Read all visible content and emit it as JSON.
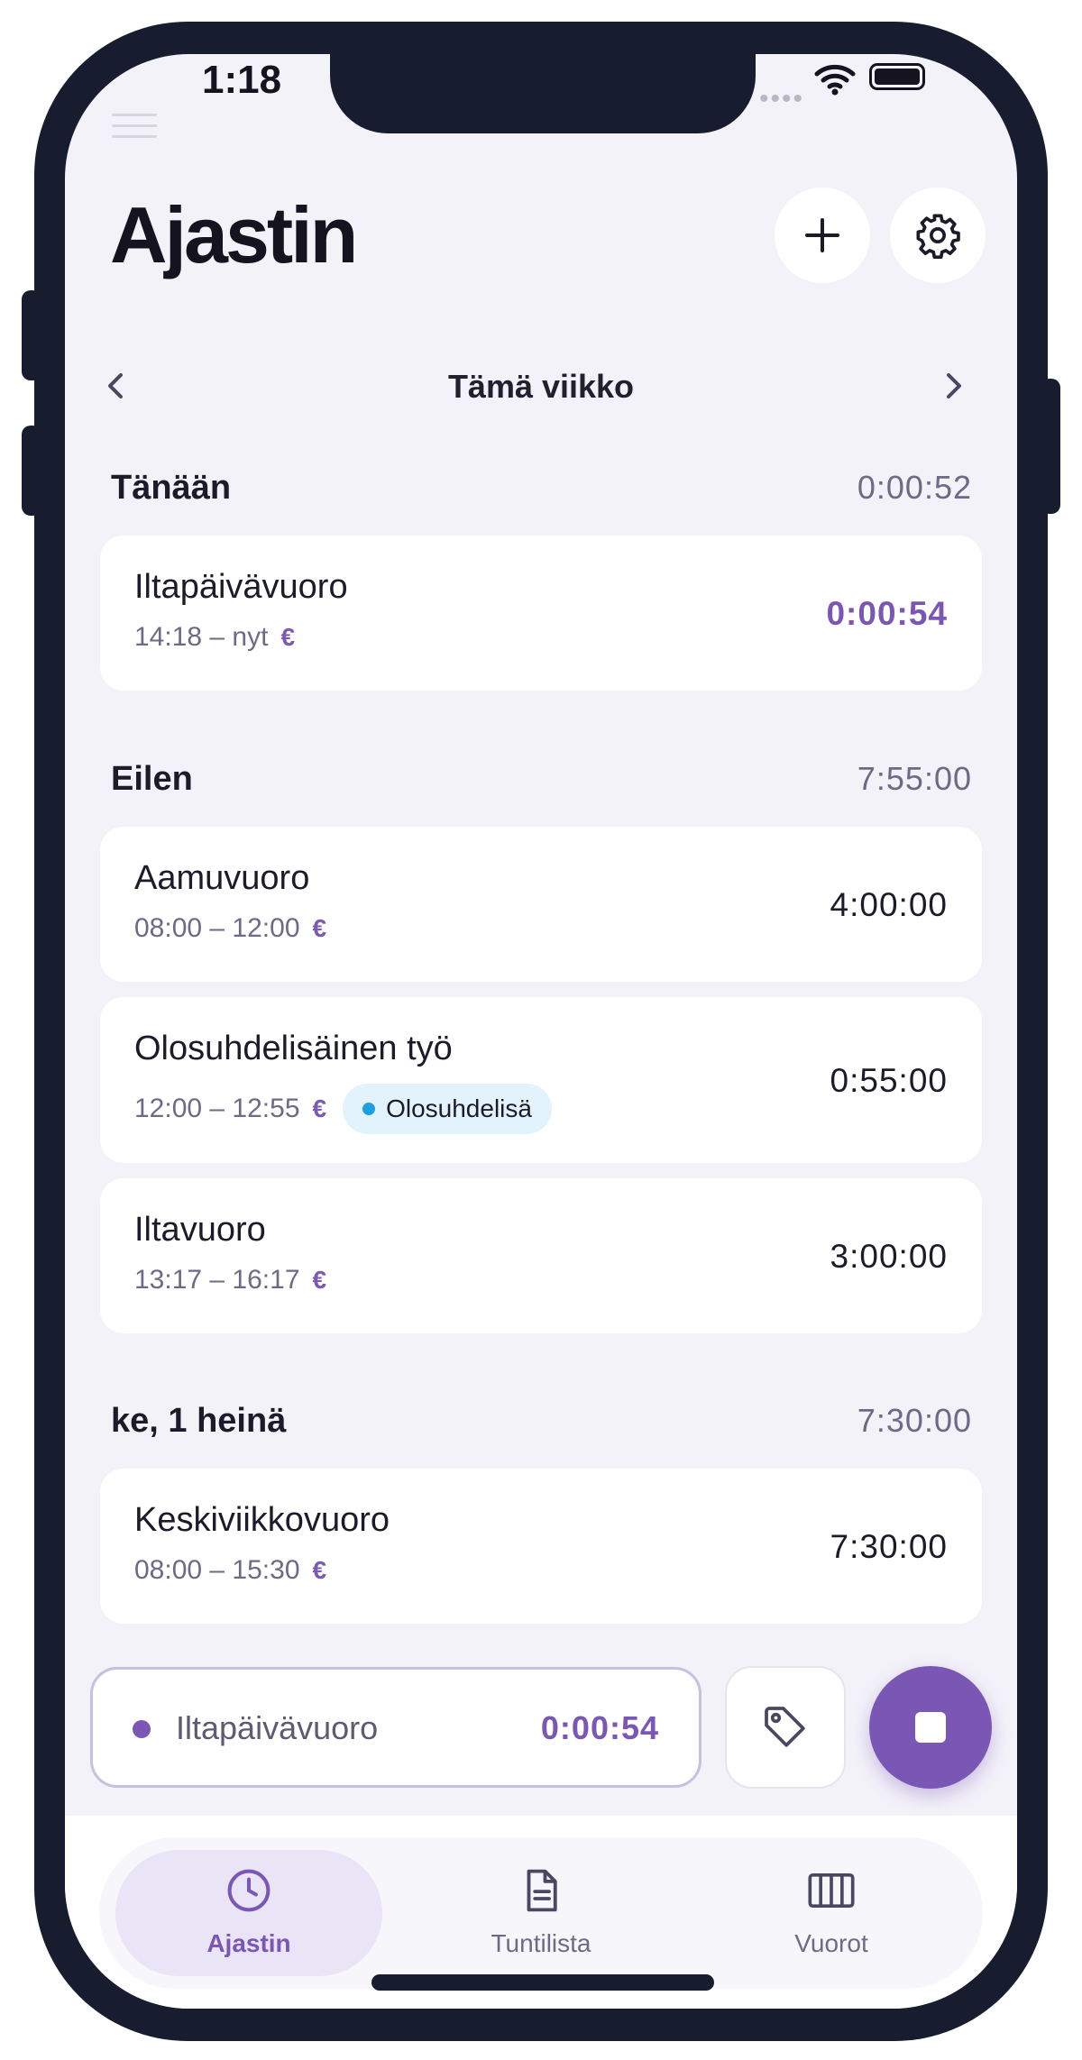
{
  "status_bar": {
    "time": "1:18",
    "signal_dots": "••••"
  },
  "header": {
    "title": "Ajastin"
  },
  "week_nav": {
    "label": "Tämä viikko"
  },
  "sections": [
    {
      "title": "Tänään",
      "total": "0:00:52",
      "entries": [
        {
          "name": "Iltapäivävuoro",
          "time_range": "14:18 – nyt",
          "currency": "€",
          "duration": "0:00:54"
        }
      ]
    },
    {
      "title": "Eilen",
      "total": "7:55:00",
      "entries": [
        {
          "name": "Aamuvuoro",
          "time_range": "08:00 – 12:00",
          "currency": "€",
          "duration": "4:00:00"
        },
        {
          "name": "Olosuhdelisäinen työ",
          "time_range": "12:00 – 12:55",
          "currency": "€",
          "tag": "Olosuhdelisä",
          "duration": "0:55:00"
        },
        {
          "name": "Iltavuoro",
          "time_range": "13:17 – 16:17",
          "currency": "€",
          "duration": "3:00:00"
        }
      ]
    },
    {
      "title": "ke, 1 heinä",
      "total": "7:30:00",
      "entries": [
        {
          "name": "Keskiviikkovuoro",
          "time_range": "08:00 – 15:30",
          "currency": "€",
          "duration": "7:30:00"
        }
      ]
    }
  ],
  "running_timer": {
    "name": "Iltapäivävuoro",
    "elapsed": "0:00:54"
  },
  "tabs": [
    {
      "label": "Ajastin",
      "icon": "clock-icon",
      "active": true
    },
    {
      "label": "Tuntilista",
      "icon": "document-icon",
      "active": false
    },
    {
      "label": "Vuorot",
      "icon": "columns-icon",
      "active": false
    }
  ],
  "colors": {
    "accent": "#7a57b5",
    "tag_dot": "#1ea0e0",
    "background": "#f3f2f9",
    "frame": "#171d2e"
  }
}
